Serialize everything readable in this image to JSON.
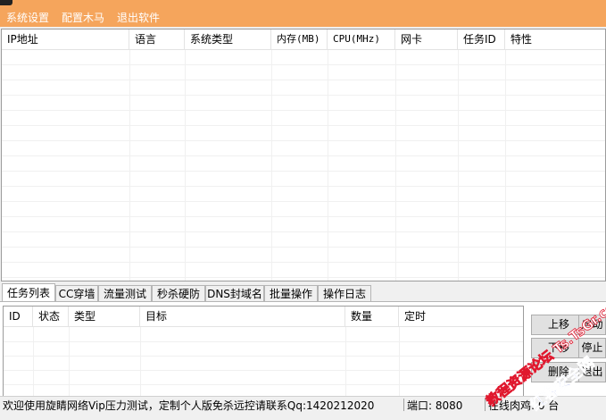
{
  "menu": {
    "items": [
      "系统设置",
      "配置木马",
      "退出软件"
    ]
  },
  "host_list": {
    "columns": [
      "IP地址",
      "语言",
      "系统类型",
      "内存(MB)",
      "CPU(MHz)",
      "网卡",
      "任务ID",
      "特性"
    ]
  },
  "tabs": [
    "任务列表",
    "CC穿墙",
    "流量测试",
    "秒杀硬防",
    "DNS封域名",
    "批量操作",
    "操作日志"
  ],
  "task_list": {
    "columns": [
      "ID",
      "状态",
      "类型",
      "目标",
      "数量",
      "定时"
    ]
  },
  "buttons": {
    "move_up": "上移",
    "move_down": "下移",
    "delete": "删除",
    "start": "启动",
    "stop": "停止",
    "exit": "退出"
  },
  "status": {
    "welcome": "欢迎使用旋睛网络Vip压力测试，定制个人版免杀远控请联系Qq:1420212020",
    "port": "端口: 8080",
    "online": "在线肉鸡: 0 台"
  },
  "watermark": {
    "line1": "教程资源论坛 Ts.TsGr.cc",
    "line2": "红客安全网"
  },
  "colors": {
    "menubar": "#f5a55c",
    "watermark_red": "#e0182e",
    "watermark_blue": "#1e3cc8"
  }
}
